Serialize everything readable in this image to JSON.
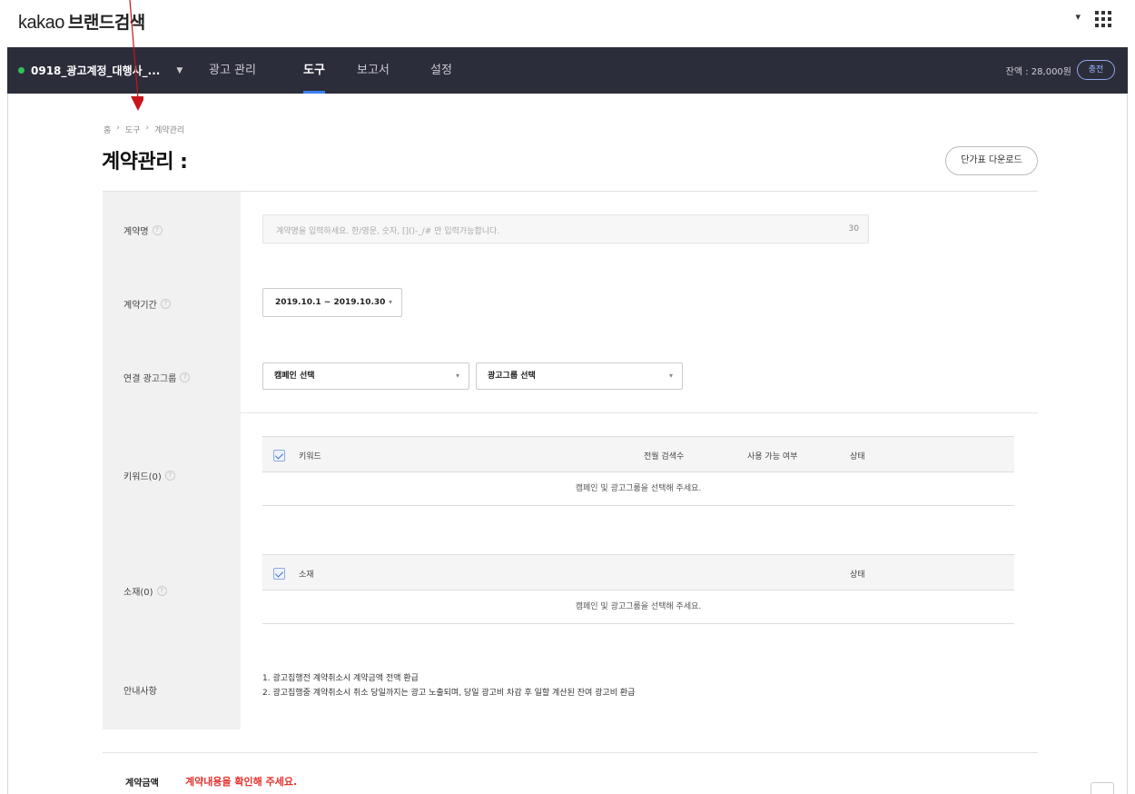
{
  "header": {
    "brand_kakao": "kakao",
    "brand_product": "브랜드검색",
    "dropdown_caret": "▾"
  },
  "nav": {
    "account": "0918_광고계정_대행사_...",
    "items": [
      {
        "label": "광고 관리",
        "active": false
      },
      {
        "label": "도구",
        "active": true
      },
      {
        "label": "보고서",
        "active": false
      },
      {
        "label": "설정",
        "active": false
      }
    ],
    "balance": "잔액 : 28,000원",
    "charge_label": "충전"
  },
  "breadcrumb": [
    "홈",
    "도구",
    "계약관리"
  ],
  "page": {
    "title": "계약관리 :",
    "download_button": "단가표 다운로드"
  },
  "form": {
    "contract_name": {
      "label": "계약명",
      "placeholder": "계약명을 입력하세요. 한/영문, 숫자, []()-_/# 만 입력가능합니다.",
      "max_length": "30"
    },
    "contract_period": {
      "label": "계약기간",
      "value": "2019.10.1 ~ 2019.10.30"
    },
    "linked_adgroup": {
      "label": "연결 광고그룹",
      "campaign_select": "캠페인 선택",
      "adgroup_select": "광고그룹 선택"
    },
    "keywords": {
      "label": "키워드(0)",
      "columns": [
        "키워드",
        "전월 검색수",
        "사용 가능 여부",
        "상태"
      ],
      "empty_message": "캠페인 및 광고그룹을 선택해 주세요."
    },
    "creatives": {
      "label": "소재(0)",
      "columns": [
        "소재",
        "상태"
      ],
      "empty_message": "캠페인 및 광고그룹을 선택해 주세요."
    },
    "notice": {
      "label": "안내사항",
      "lines": [
        "1. 광고집행전 계약취소시 계약금액 전액 환급",
        "2. 광고집행중 계약취소시 취소 당일까지는 광고 노출되며, 당일 광고비 차감 후 일할 계산된 잔여 광고비 환급"
      ]
    },
    "amount": {
      "label": "계약금액",
      "message": "계약내용을 확인해 주세요."
    }
  },
  "colors": {
    "nav_bg": "#2c2d3a",
    "accent": "#3d7ff0",
    "status_dot": "#2ec25b",
    "warning": "#e5322d",
    "annotation_arrow": "#c8141c"
  },
  "help_glyph": "?"
}
